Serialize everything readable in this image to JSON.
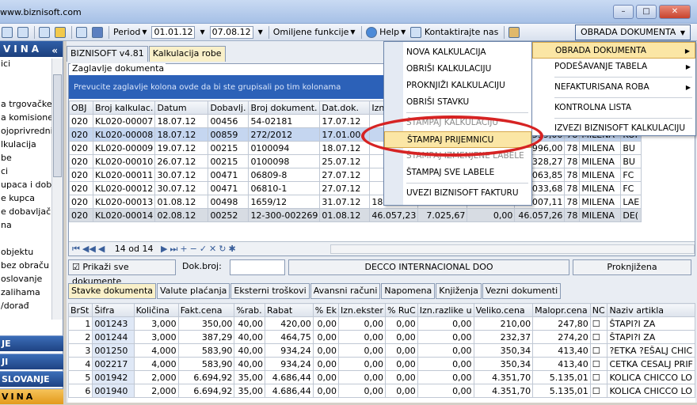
{
  "titlebar": {
    "title": "www.biznisoft.com",
    "min": "–",
    "max": "□",
    "close": "✕"
  },
  "toolbar": {
    "period_label": "Period",
    "date_from": "01.01.12",
    "date_to": "07.08.12",
    "omiljene": "Omiljene funkcije",
    "help": "Help",
    "kontakt": "Kontaktirajte nas",
    "obrada": "OBRADA DOKUMENTA"
  },
  "left": {
    "header": "VINA",
    "chev": "«",
    "items": [
      "ici",
      "",
      "",
      "a trgovačke",
      "a komisione",
      "ojoprivredni",
      "lkulacija",
      "be",
      "ci",
      "upaca i dob",
      "e kupca",
      "e dobavljač",
      "na",
      "",
      "objektu",
      "bez obraču",
      "oslovanje",
      "zalihama",
      "/dorađ"
    ],
    "bottom": [
      "JE",
      "JI",
      "SLOVANJE",
      "VINA"
    ]
  },
  "main": {
    "tabs": [
      "BIZNISOFT v4.81",
      "Kalkulacija robe"
    ],
    "group_label": "Zaglavlje dokumenta",
    "group_hint": "Prevucite zaglavlje kolona ovde da bi ste grupisali po tim kolonama",
    "columns": [
      "OBJ",
      "Broj kalkulac.",
      "Datum",
      "Dobavlj.",
      "Broj dokument.",
      "Dat.dok.",
      "Izn.za",
      "",
      "",
      "",
      "",
      "",
      ""
    ],
    "rows": [
      [
        "020",
        "KL020-00007",
        "18.07.12",
        "00456",
        "54-02181",
        "17.07.12",
        "",
        "",
        "",
        "",
        "",
        "",
        ""
      ],
      [
        "020",
        "KL020-00008",
        "18.07.12",
        "00859",
        "272/2012",
        "17.01.00",
        "2",
        "",
        "",
        "44.539,00",
        "78",
        "MILENA",
        "KOI"
      ],
      [
        "020",
        "KL020-00009",
        "19.07.12",
        "00215",
        "0100094",
        "18.07.12",
        "",
        "",
        "",
        "50.996,00",
        "78",
        "MILENA",
        "BU"
      ],
      [
        "020",
        "KL020-00010",
        "26.07.12",
        "00215",
        "0100098",
        "25.07.12",
        "1",
        "",
        "",
        "11.328,27",
        "78",
        "MILENA",
        "BU"
      ],
      [
        "020",
        "KL020-00011",
        "30.07.12",
        "00471",
        "06809-8",
        "27.07.12",
        "4",
        "",
        "",
        "61.063,85",
        "78",
        "MILENA",
        "FC"
      ],
      [
        "020",
        "KL020-00012",
        "30.07.12",
        "00471",
        "06810-1",
        "27.07.12",
        "4",
        "",
        "",
        "40.033,68",
        "78",
        "MILENA",
        "FC"
      ],
      [
        "020",
        "KL020-00013",
        "01.08.12",
        "00498",
        "1659/12",
        "31.07.12",
        "18.007,11",
        "2.746,86",
        "0,00",
        "18.007,11",
        "78",
        "MILENA",
        "LAE"
      ],
      [
        "020",
        "KL020-00014",
        "02.08.12",
        "00252",
        "12-300-002269",
        "01.08.12",
        "46.057,23",
        "7.025,67",
        "0,00",
        "46.057,26",
        "78",
        "MILENA",
        "DE("
      ]
    ],
    "nav_count": "14 od 14",
    "show_all": "Prikaži sve dokumente",
    "dok_broj": "Dok.broj:",
    "company": "DECCO INTERNACIONAL DOO",
    "status": "Proknjižena"
  },
  "tabs2": [
    "Stavke dokumenta",
    "Valute plaćanja",
    "Eksterni troškovi",
    "Avansni računi",
    "Napomena",
    "Knjiženja",
    "Vezni dokumenti"
  ],
  "items_table": {
    "columns": [
      "BrSt",
      "Šifra",
      "Količina",
      "Fakt.cena",
      "%rab.",
      "Rabat",
      "% Ek",
      "Izn.ekster",
      "% RuC",
      "Izn.razlike u",
      "Veliko.cena",
      "Malopr.cena",
      "NC",
      "Naziv artikla"
    ],
    "rows": [
      [
        "1",
        "001243",
        "3,000",
        "350,00",
        "40,00",
        "420,00",
        "0,00",
        "0,00",
        "0,00",
        "0,00",
        "210,00",
        "247,80",
        "",
        "ŠTAPI?I ZA"
      ],
      [
        "2",
        "001244",
        "3,000",
        "387,29",
        "40,00",
        "464,75",
        "0,00",
        "0,00",
        "0,00",
        "0,00",
        "232,37",
        "274,20",
        "",
        "ŠTAPI?I ZA"
      ],
      [
        "3",
        "001250",
        "4,000",
        "583,90",
        "40,00",
        "934,24",
        "0,00",
        "0,00",
        "0,00",
        "0,00",
        "350,34",
        "413,40",
        "",
        "?ETKA ?EŠALJ CHIC"
      ],
      [
        "4",
        "002217",
        "4,000",
        "583,90",
        "40,00",
        "934,24",
        "0,00",
        "0,00",
        "0,00",
        "0,00",
        "350,34",
        "413,40",
        "",
        "CETKA CESALJ PRIF"
      ],
      [
        "5",
        "001942",
        "2,000",
        "6.694,92",
        "35,00",
        "4.686,44",
        "0,00",
        "0,00",
        "0,00",
        "0,00",
        "4.351,70",
        "5.135,01",
        "",
        "KOLICA CHICCO LO"
      ],
      [
        "6",
        "001940",
        "2,000",
        "6.694,92",
        "35,00",
        "4.686,44",
        "0,00",
        "0,00",
        "0,00",
        "0,00",
        "4.351,70",
        "5.135,01",
        "",
        "KOLICA CHICCO LO"
      ]
    ]
  },
  "menu1": [
    "NOVA KALKULACIJA",
    "OBRIŠI KALKULACIJU",
    "PROKNJIŽI KALKULACIJU",
    "OBRIŠI STAVKU",
    "ŠTAMPAJ KALKULACIJU",
    "ŠTAMPAJ PRIJEMNICU",
    "ŠTAMPAJ IZMENJENE LABELE",
    "ŠTAMPAJ SVE LABELE",
    "UVEZI BIZNISOFT FAKTURU"
  ],
  "menu2": [
    "OBRADA DOKUMENTA",
    "PODEŠAVANJE TABELA",
    "NEFAKTURISANA ROBA",
    "KONTROLNA LISTA",
    "IZVEZI BIZNISOFT KALKULACIJU"
  ]
}
